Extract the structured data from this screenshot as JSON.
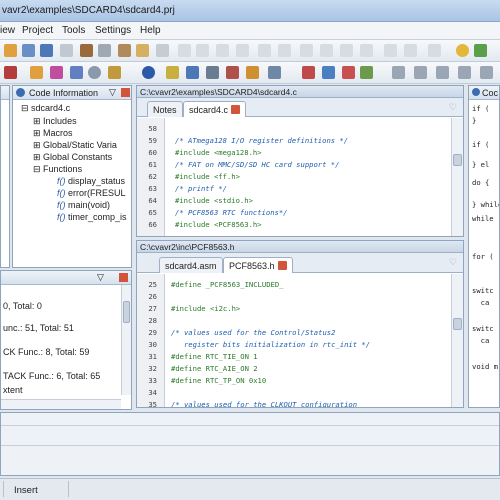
{
  "window": {
    "title": "vavr2\\examples\\SDCARD4\\sdcard4.prj"
  },
  "menu": [
    "iew",
    "Project",
    "Tools",
    "Settings",
    "Help"
  ],
  "code_info": {
    "title": "Code Information",
    "root": "sdcard4.c",
    "items": [
      "Includes",
      "Macros",
      "Global/Static Varia",
      "Global Constants",
      "Functions"
    ],
    "functions": [
      "display_status",
      "error(FRESUL",
      "main(void)",
      "timer_comp_is"
    ]
  },
  "stats": [
    "0, Total: 0",
    "unc.: 51, Total: 51",
    "CK Func.: 8, Total: 59",
    "TACK Func.: 6, Total: 65",
    "xtent"
  ],
  "editor1": {
    "path": "C:\\cvavr2\\examples\\SDCARD4\\sdcard4.c",
    "tabs": [
      "Notes",
      "sdcard4.c"
    ],
    "lines": [
      "58",
      "59",
      "60",
      "61",
      "62",
      "63",
      "64",
      "65",
      "66"
    ],
    "code": [
      "",
      "/* ATmega128 I/O register definitions */",
      "#include <mega128.h>",
      "/* FAT on MMC/SD/SD HC card support */",
      "#include <ff.h>",
      "/* printf */",
      "#include <stdio.h>",
      "/* PCF8563 RTC functions*/",
      "#include <PCF8563.h>"
    ]
  },
  "editor2": {
    "path": "C:\\cvavr2\\inc\\PCF8563.h",
    "tabs": [
      "sdcard4.asm",
      "PCF8563.h"
    ],
    "lines": [
      "25",
      "26",
      "27",
      "28",
      "29",
      "30",
      "31",
      "32",
      "33",
      "34",
      "35"
    ],
    "code": [
      "#define _PCF8563_INCLUDED_",
      "",
      "#include <i2c.h>",
      "",
      "/* values used for the Control/Status2",
      "   register bits initialization in rtc_init */",
      "#define RTC_TIE_ON 1",
      "#define RTC_AIE_ON 2",
      "#define RTC_TP_ON 0x10",
      "",
      "/* values used for the CLKOUT configuration"
    ]
  },
  "templates": {
    "title": "Coc",
    "snippets": [
      "if (",
      "} ",
      "if (",
      "} el",
      "do {",
      "} while",
      "while",
      "for (",
      "switc",
      "  ca",
      "switc",
      "  ca",
      "void m"
    ]
  },
  "status": {
    "mode": "Insert"
  }
}
